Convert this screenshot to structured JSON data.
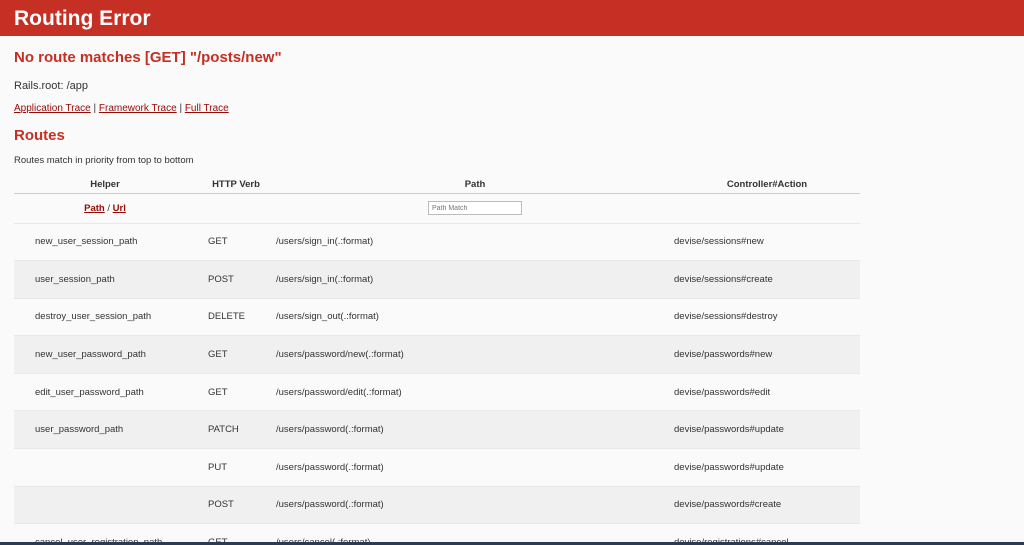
{
  "header": {
    "title": "Routing Error"
  },
  "error": {
    "title": "No route matches [GET] \"/posts/new\"",
    "rails_root": "Rails.root: /app"
  },
  "traces": {
    "application": "Application Trace",
    "framework": "Framework Trace",
    "full": "Full Trace",
    "separator": " | "
  },
  "routes": {
    "title": "Routes",
    "note": "Routes match in priority from top to bottom",
    "columns": {
      "helper": "Helper",
      "verb": "HTTP Verb",
      "path": "Path",
      "controller": "Controller#Action"
    },
    "filter": {
      "path_link": "Path",
      "slash": " / ",
      "url_link": "Url",
      "path_match_placeholder": "Path Match"
    },
    "rows": [
      {
        "helper": "new_user_session_path",
        "verb": "GET",
        "path": "/users/sign_in(.:format)",
        "controller": "devise/sessions#new"
      },
      {
        "helper": "user_session_path",
        "verb": "POST",
        "path": "/users/sign_in(.:format)",
        "controller": "devise/sessions#create"
      },
      {
        "helper": "destroy_user_session_path",
        "verb": "DELETE",
        "path": "/users/sign_out(.:format)",
        "controller": "devise/sessions#destroy"
      },
      {
        "helper": "new_user_password_path",
        "verb": "GET",
        "path": "/users/password/new(.:format)",
        "controller": "devise/passwords#new"
      },
      {
        "helper": "edit_user_password_path",
        "verb": "GET",
        "path": "/users/password/edit(.:format)",
        "controller": "devise/passwords#edit"
      },
      {
        "helper": "user_password_path",
        "verb": "PATCH",
        "path": "/users/password(.:format)",
        "controller": "devise/passwords#update"
      },
      {
        "helper": "",
        "verb": "PUT",
        "path": "/users/password(.:format)",
        "controller": "devise/passwords#update"
      },
      {
        "helper": "",
        "verb": "POST",
        "path": "/users/password(.:format)",
        "controller": "devise/passwords#create"
      },
      {
        "helper": "cancel_user_registration_path",
        "verb": "GET",
        "path": "/users/cancel(.:format)",
        "controller": "devise/registrations#cancel"
      }
    ]
  },
  "colors": {
    "header_bg": "#c52f24",
    "link": "#980905",
    "row_alt": "#f0f0f0"
  }
}
